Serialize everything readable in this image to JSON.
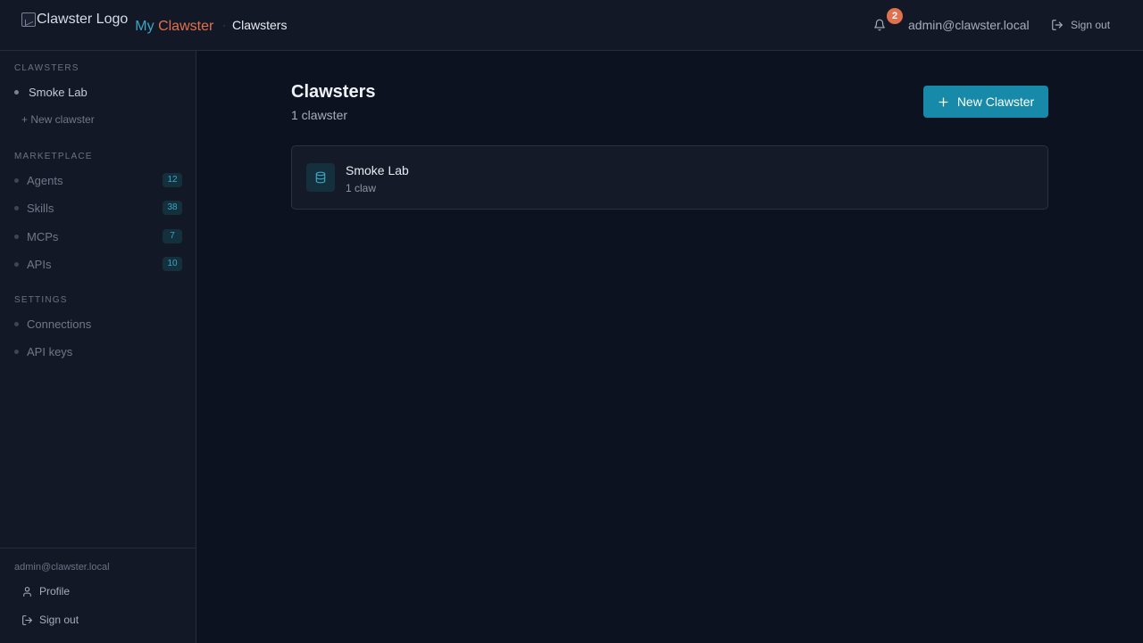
{
  "header": {
    "logo_alt": "Clawster Logo",
    "brand_prefix": "My",
    "brand_name": "Clawster",
    "breadcrumb_separator": "·",
    "breadcrumb_current": "Clawsters",
    "notification_count": "2",
    "user_email": "admin@clawster.local",
    "sign_out_label": "Sign out"
  },
  "sidebar": {
    "sections": {
      "clawsters": "CLAWSTERS",
      "marketplace": "MARKETPLACE",
      "settings": "SETTINGS"
    },
    "clawsters_items": [
      {
        "label": "Smoke Lab",
        "active": true
      }
    ],
    "new_clawster_link": "+ New clawster",
    "marketplace_items": [
      {
        "label": "Agents",
        "count": "12"
      },
      {
        "label": "Skills",
        "count": "38"
      },
      {
        "label": "MCPs",
        "count": "7"
      },
      {
        "label": "APIs",
        "count": "10"
      }
    ],
    "settings_items": [
      {
        "label": "Connections"
      },
      {
        "label": "API keys"
      }
    ],
    "footer": {
      "email": "admin@clawster.local",
      "profile_label": "Profile",
      "sign_out_label": "Sign out"
    }
  },
  "main": {
    "title": "Clawsters",
    "subtitle": "1 clawster",
    "new_button_label": "New Clawster",
    "cards": [
      {
        "title": "Smoke Lab",
        "subtitle": "1 claw",
        "icon": "database-icon"
      }
    ]
  },
  "colors": {
    "accent": "#168aa8",
    "brand_teal": "#3aa6c4",
    "brand_orange": "#e1714e",
    "background": "#0d1220",
    "panel": "#131826"
  }
}
